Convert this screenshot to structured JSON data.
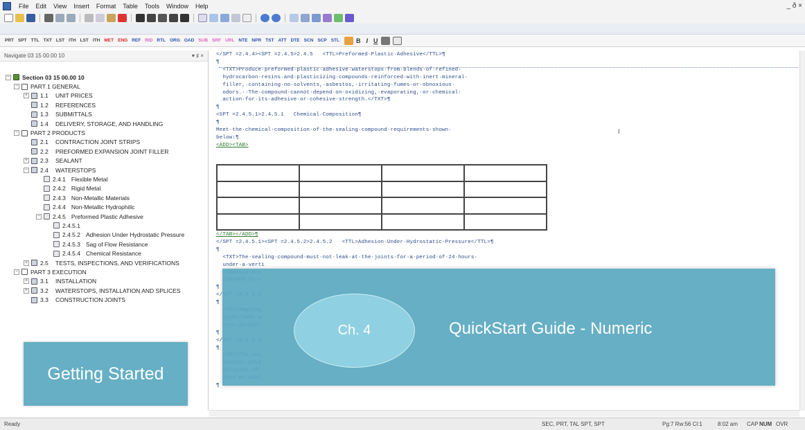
{
  "app": {
    "menu": [
      "File",
      "Edit",
      "View",
      "Insert",
      "Format",
      "Table",
      "Tools",
      "Window",
      "Help"
    ],
    "window_controls": "_ ð ×"
  },
  "tag_toolbar": {
    "tags": [
      "PRT",
      "SPT",
      "TTL",
      "TXT",
      "LST",
      "ITH",
      "LST",
      "ITH",
      "MET",
      "ENG",
      "REF",
      "RID",
      "RTL",
      "ORG",
      "OAD",
      "SUB",
      "SRF",
      "URL",
      "NTE",
      "NPR",
      "TST",
      "ATT",
      "DTE",
      "SCN",
      "SCP",
      "STL"
    ],
    "format_buttons": [
      "B",
      "I",
      "U"
    ]
  },
  "nav": {
    "header": "Navigate 03 15 00.00 10",
    "header_controls": "▾ ♯ ×",
    "items": [
      {
        "level": 0,
        "expander": "−",
        "icon": "sec",
        "num": "",
        "label": "Section 03 15 00.00 10",
        "bold": true
      },
      {
        "level": 1,
        "expander": "−",
        "icon": "part",
        "num": "",
        "label": "PART 1  GENERAL"
      },
      {
        "level": 2,
        "expander": "+",
        "icon": "art",
        "num": "1.1",
        "label": "UNIT PRICES"
      },
      {
        "level": 2,
        "expander": "",
        "icon": "art",
        "num": "1.2",
        "label": "REFERENCES"
      },
      {
        "level": 2,
        "expander": "",
        "icon": "art",
        "num": "1.3",
        "label": "SUBMITTALS"
      },
      {
        "level": 2,
        "expander": "",
        "icon": "art",
        "num": "1.4",
        "label": "DELIVERY, STORAGE, AND HANDLING"
      },
      {
        "level": 1,
        "expander": "−",
        "icon": "part",
        "num": "",
        "label": "PART 2  PRODUCTS"
      },
      {
        "level": 2,
        "expander": "",
        "icon": "art",
        "num": "2.1",
        "label": "CONTRACTION JOINT STRIPS"
      },
      {
        "level": 2,
        "expander": "",
        "icon": "art",
        "num": "2.2",
        "label": "PREFORMED EXPANSION JOINT FILLER"
      },
      {
        "level": 2,
        "expander": "+",
        "icon": "art",
        "num": "2.3",
        "label": "SEALANT"
      },
      {
        "level": 2,
        "expander": "−",
        "icon": "art",
        "num": "2.4",
        "label": "WATERSTOPS"
      },
      {
        "level": 3,
        "expander": "",
        "icon": "par",
        "num": "2.4.1",
        "label": "Flexible Metal"
      },
      {
        "level": 3,
        "expander": "",
        "icon": "par",
        "num": "2.4.2",
        "label": "Rigid Metal"
      },
      {
        "level": 3,
        "expander": "",
        "icon": "par",
        "num": "2.4.3",
        "label": "Non-Metallic Materials"
      },
      {
        "level": 3,
        "expander": "",
        "icon": "par",
        "num": "2.4.4",
        "label": "Non-Metallic Hydrophilic"
      },
      {
        "level": 3,
        "expander": "−",
        "icon": "par",
        "num": "2.4.5",
        "label": "Preformed Plastic Adhesive"
      },
      {
        "level": 4,
        "expander": "",
        "icon": "par",
        "num": "2.4.5.1",
        "label": ""
      },
      {
        "level": 4,
        "expander": "",
        "icon": "par",
        "num": "2.4.5.2",
        "label": "Adhesion Under Hydrostatic Pressure"
      },
      {
        "level": 4,
        "expander": "",
        "icon": "par",
        "num": "2.4.5.3",
        "label": "Sag of Flow Resistance"
      },
      {
        "level": 4,
        "expander": "",
        "icon": "par",
        "num": "2.4.5.4",
        "label": "Chemical Resistance"
      },
      {
        "level": 2,
        "expander": "+",
        "icon": "art",
        "num": "2.5",
        "label": "TESTS, INSPECTIONS, AND VERIFICATIONS"
      },
      {
        "level": 1,
        "expander": "−",
        "icon": "part",
        "num": "",
        "label": "PART 3  EXECUTION"
      },
      {
        "level": 2,
        "expander": "+",
        "icon": "art",
        "num": "3.1",
        "label": "INSTALLATION"
      },
      {
        "level": 2,
        "expander": "+",
        "icon": "art",
        "num": "3.2",
        "label": "WATERSTOPS, INSTALLATION AND SPLICES"
      },
      {
        "level": 2,
        "expander": "",
        "icon": "art",
        "num": "3.3",
        "label": "CONSTRUCTION JOINTS"
      }
    ]
  },
  "editor": {
    "lines": [
      {
        "text": "</SPT =2.4.4><SPT =2.4.5>2.4.5   <TTL>Preformed·Plastic·Adhesive</TTL>¶",
        "style": "n"
      },
      {
        "text": "¶",
        "style": "n"
      },
      {
        "text": "  <TXT>Produce·preformed·plastic·adhesive·waterstops·from·blends·of·refined·",
        "style": "n"
      },
      {
        "text": "  hydrocarbon·resins·and·plasticizing·compounds·reinforced·with·inert·mineral·",
        "style": "n"
      },
      {
        "text": "  filler,·containing·no·solvents,·asbestos,·irritating·fumes·or·obnoxious·",
        "style": "n"
      },
      {
        "text": "  odors.··The·compound·cannot·depend·on·oxidizing,·evaporating,·or·chemical·",
        "style": "n"
      },
      {
        "text": "  action·for·its·adhesive·or·cohesive·strength.</TXT>¶",
        "style": "n"
      },
      {
        "text": "¶",
        "style": "n"
      },
      {
        "text": "<SPT =2.4.5.1>2.4.5.1   Chemical·Composition¶",
        "style": "n"
      },
      {
        "text": "¶",
        "style": "n"
      },
      {
        "text": "Meet·the·chemical·composition·of·the·sealing·compound·requirements·shown·",
        "style": "n"
      },
      {
        "text": "below:¶",
        "style": "n"
      },
      {
        "text": "<ADD><TAB>",
        "style": "g"
      },
      {
        "text": "</TAB></ADD>¶",
        "style": "g"
      },
      {
        "text": "</SPT =2.4.5.1><SPT =2.4.5.2>2.4.5.2   <TTL>Adhesion·Under·Hydrostatic·Pressure</TTL>¶",
        "style": "n"
      },
      {
        "text": "¶",
        "style": "n"
      },
      {
        "text": "  <TXT>The·sealing·compound·must·not·leak·at·the·joints·for·a·period·of·24·hours·",
        "style": "n"
      },
      {
        "text": "  under·a·verti",
        "style": "n"
      },
      {
        "text": "  compound·mus",
        "style": "n"
      },
      {
        "text": "  reached·by·s",
        "style": "n"
      },
      {
        "text": "¶",
        "style": "n"
      },
      {
        "text": "</SPT =2.4.5.2",
        "style": "n"
      },
      {
        "text": "¶",
        "style": "n"
      },
      {
        "text": "  <TXT>Sagging",
        "style": "n"
      },
      {
        "text": "  inch</ENG>·w",
        "style": "n"
      },
      {
        "text": "  oven·at<ENG>",
        "style": "n"
      },
      {
        "text": "¶",
        "style": "n"
      },
      {
        "text": "</SPT =2.4.5.3",
        "style": "n"
      },
      {
        "text": "¶",
        "style": "n"
      },
      {
        "text": "  <TXT>The·sea",
        "style": "n"
      },
      {
        "text": "  caustic·pota",
        "style": "n"
      },
      {
        "text": "  solution·of·",
        "style": "n"
      },
      {
        "text": "  days·at·ambi",
        "style": "n"
      },
      {
        "text": "¶",
        "style": "n"
      }
    ],
    "cursor_glyph": "I"
  },
  "status": {
    "left": "Ready",
    "context": "SEC, PRT, TAL SPT, SPT",
    "position": "Pg:7 Rw:56 Cl:1",
    "time": "8:02 am",
    "cap": "CAP",
    "num": "NUM",
    "ovr": "OVR"
  },
  "overlays": {
    "getting_started": "Getting Started",
    "chapter": "Ch. 4",
    "guide_title": "QuickStart Guide - Numeric"
  },
  "colors": {
    "overlay": "#5aa9c1",
    "ellipse": "#8fd0e2",
    "code_text": "#2e4d88",
    "markup_green": "#2d7a2d"
  }
}
